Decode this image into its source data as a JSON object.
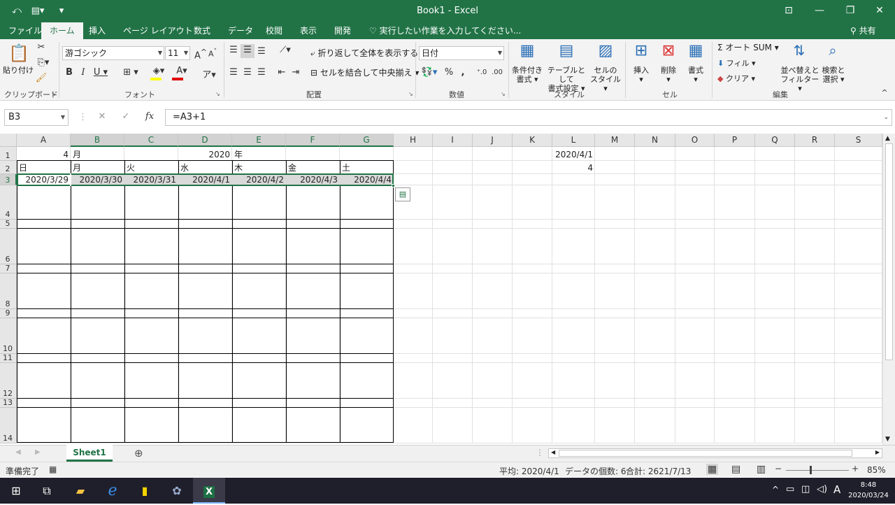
{
  "window": {
    "title": "Book1 - Excel",
    "qat_autosave_icon": "touch-mode-icon",
    "qat_customize": "▾"
  },
  "tabs": [
    "ファイル",
    "ホーム",
    "挿入",
    "ページ レイアウト",
    "数式",
    "データ",
    "校閲",
    "表示",
    "開発"
  ],
  "tell_me": "実行したい作業を入力してください...",
  "share": "共有",
  "ribbon": {
    "clipboard": {
      "paste": "貼り付け",
      "label": "クリップボード"
    },
    "font": {
      "name": "游ゴシック",
      "size": "11",
      "label": "フォント"
    },
    "align": {
      "wrap": "折り返して全体を表示する",
      "merge": "セルを結合して中央揃え",
      "label": "配置"
    },
    "number": {
      "format": "日付",
      "label": "数値"
    },
    "styles": {
      "cond_l1": "条件付き",
      "cond_l2": "書式",
      "table_l1": "テーブルとして",
      "table_l2": "書式設定",
      "cell_l1": "セルの",
      "cell_l2": "スタイル",
      "label": "スタイル"
    },
    "cells": {
      "insert": "挿入",
      "delete": "削除",
      "format": "書式",
      "label": "セル"
    },
    "editing": {
      "autosum": "オート SUM",
      "fill": "フィル",
      "clear": "クリア",
      "sort_l1": "並べ替えと",
      "sort_l2": "フィルター",
      "find_l1": "検索と",
      "find_l2": "選択",
      "label": "編集"
    }
  },
  "formula_bar": {
    "name_box": "B3",
    "formula": "=A3+1",
    "fx": "fx"
  },
  "columns": [
    "A",
    "B",
    "C",
    "D",
    "E",
    "F",
    "G",
    "H",
    "I",
    "J",
    "K",
    "L",
    "M",
    "N",
    "O",
    "P",
    "Q",
    "R",
    "S"
  ],
  "rows": [
    "1",
    "2",
    "3",
    "4",
    "5",
    "6",
    "7",
    "8",
    "9",
    "10",
    "11",
    "12",
    "13",
    "14"
  ],
  "cells": {
    "A1": "4",
    "B1": "月",
    "D1": "2020",
    "E1": "年",
    "L1": "2020/4/1",
    "A2": "日",
    "B2": "月",
    "C2": "火",
    "D2": "水",
    "E2": "木",
    "F2": "金",
    "G2": "土",
    "L2": "4",
    "A3": "2020/3/29",
    "B3": "2020/3/30",
    "C3": "2020/3/31",
    "D3": "2020/4/1",
    "E3": "2020/4/2",
    "F3": "2020/4/3",
    "G3": "2020/4/4"
  },
  "sheet_tab": "Sheet1",
  "status": {
    "ready": "準備完了",
    "average": "平均: 2020/4/1",
    "count": "データの個数: 6",
    "sum": "合計: 2621/7/13",
    "zoom": "85%"
  },
  "taskbar": {
    "time": "8:48",
    "date": "2020/03/24",
    "ime": "A"
  }
}
